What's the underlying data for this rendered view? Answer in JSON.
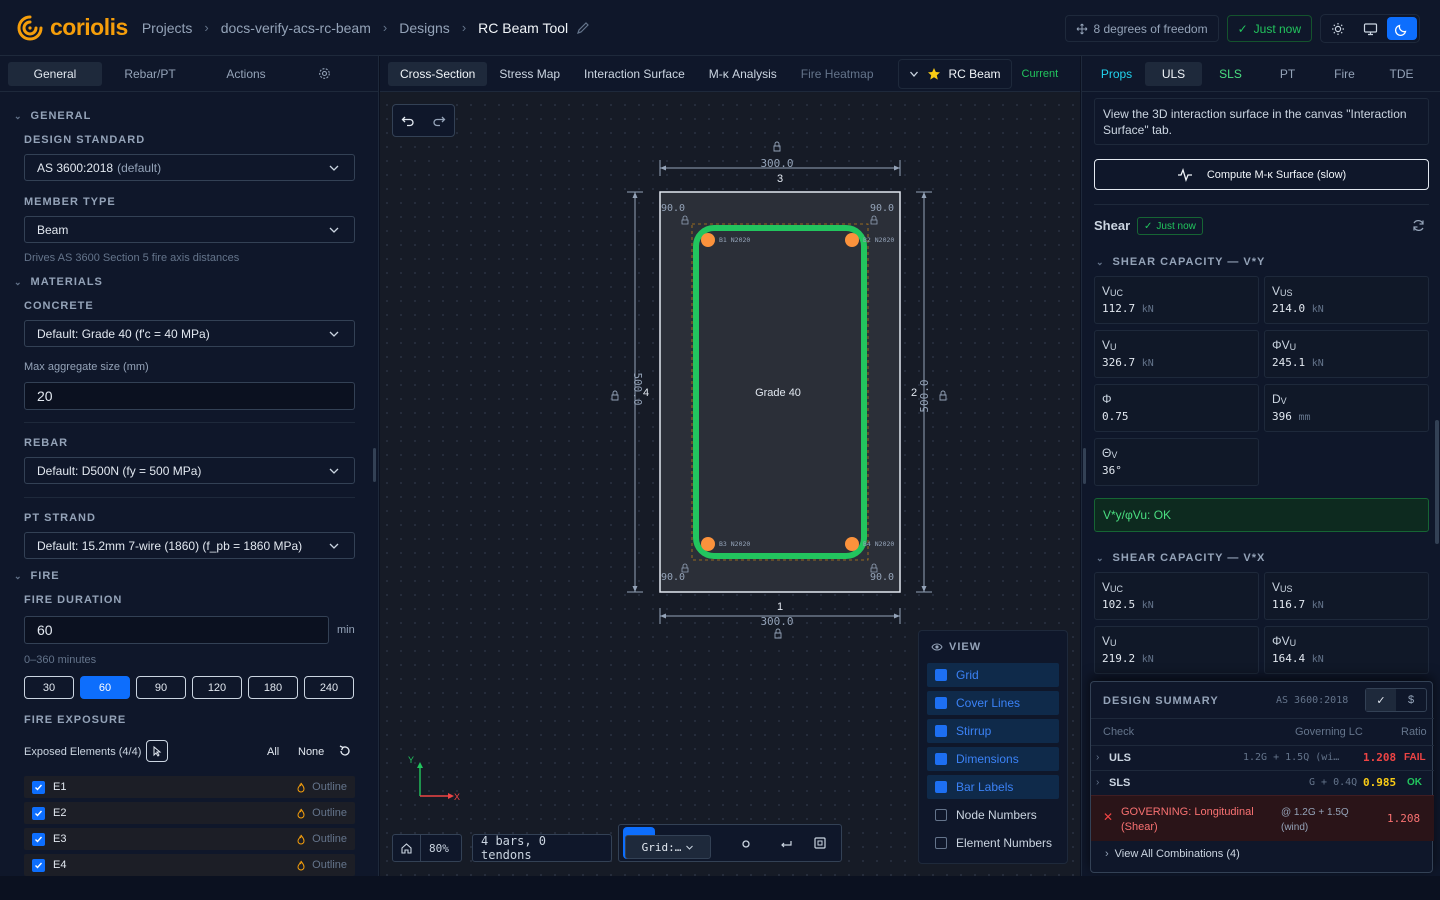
{
  "app": {
    "name": "coriolis"
  },
  "breadcrumb": [
    "Projects",
    "docs-verify-acs-rc-beam",
    "Designs",
    "RC Beam Tool"
  ],
  "topbar": {
    "dof": "8 degrees of freedom",
    "saved": "Just now"
  },
  "left": {
    "tabs": [
      "General",
      "Rebar/PT",
      "Actions"
    ],
    "sections": {
      "general": "GENERAL",
      "materials": "MATERIALS",
      "fire": "FIRE"
    },
    "design_standard": {
      "label": "DESIGN STANDARD",
      "value": "AS 3600:2018",
      "suffix": "(default)"
    },
    "member_type": {
      "label": "MEMBER TYPE",
      "value": "Beam",
      "hint": "Drives AS 3600 Section 5 fire axis distances"
    },
    "concrete": {
      "label": "CONCRETE",
      "value": "Default: Grade 40 (f'c = 40 MPa)"
    },
    "aggregate": {
      "label": "Max aggregate size (mm)",
      "value": "20"
    },
    "rebar": {
      "label": "REBAR",
      "value": "Default: D500N (fy = 500 MPa)"
    },
    "pt": {
      "label": "PT STRAND",
      "value": "Default: 15.2mm 7-wire (1860) (f_pb = 1860 MPa)"
    },
    "fire_duration": {
      "label": "FIRE DURATION",
      "value": "60",
      "unit": "min",
      "hint": "0–360 minutes",
      "options": [
        "30",
        "60",
        "90",
        "120",
        "180",
        "240"
      ]
    },
    "fire_exposure": {
      "label": "FIRE EXPOSURE",
      "exposed": "Exposed Elements (4/4)",
      "all": "All",
      "none": "None",
      "elements": [
        "E1",
        "E2",
        "E3",
        "E4"
      ],
      "outline": "Outline"
    }
  },
  "canvas": {
    "tabs": [
      "Cross-Section",
      "Stress Map",
      "Interaction Surface",
      "M-κ Analysis",
      "Fire Heatmap"
    ],
    "design_name": "RC Beam",
    "status": "Current",
    "section": {
      "material": "Grade 40",
      "width": "300.0",
      "depth": "500.0",
      "cover_labels": [
        "90.0",
        "90.0",
        "90.0",
        "90.0"
      ],
      "edges": [
        "1",
        "2",
        "3",
        "4"
      ],
      "bars": [
        "B1 N2020",
        "B2 N2020",
        "B3 N2020",
        "B4 N2020"
      ]
    },
    "axes": {
      "x": "X",
      "y": "Y"
    },
    "zoom": "80%",
    "bar_count": "4 bars, 0 tendons",
    "grid_select": "Grid:…",
    "view": {
      "title": "VIEW",
      "items": [
        {
          "label": "Grid",
          "on": true
        },
        {
          "label": "Cover Lines",
          "on": true
        },
        {
          "label": "Stirrup",
          "on": true
        },
        {
          "label": "Dimensions",
          "on": true
        },
        {
          "label": "Bar Labels",
          "on": true
        },
        {
          "label": "Node Numbers",
          "on": false
        },
        {
          "label": "Element Numbers",
          "on": false
        }
      ]
    }
  },
  "right": {
    "tabs": [
      "Props",
      "ULS",
      "SLS",
      "PT",
      "Fire",
      "TDE"
    ],
    "info": "View the 3D interaction surface in the canvas \"Interaction Surface\" tab.",
    "compute_label": "Compute M-κ Surface (slow)",
    "shear": {
      "title": "Shear",
      "badge": "Just now"
    },
    "shear_y": {
      "title": "SHEAR CAPACITY — V*Y",
      "cards": [
        {
          "k": "V",
          "sub": "UC",
          "v": "112.7",
          "u": "kN"
        },
        {
          "k": "V",
          "sub": "US",
          "v": "214.0",
          "u": "kN"
        },
        {
          "k": "V",
          "sub": "U",
          "v": "326.7",
          "u": "kN"
        },
        {
          "k": "ΦV",
          "sub": "U",
          "v": "245.1",
          "u": "kN"
        },
        {
          "k": "Φ",
          "sub": "",
          "v": "0.75",
          "u": ""
        },
        {
          "k": "D",
          "sub": "V",
          "v": "396",
          "u": "mm"
        },
        {
          "k": "Θ",
          "sub": "V",
          "v": "36°",
          "u": ""
        }
      ],
      "status": "V*y/φVu: OK"
    },
    "shear_x": {
      "title": "SHEAR CAPACITY — V*X",
      "cards": [
        {
          "k": "V",
          "sub": "UC",
          "v": "102.5",
          "u": "kN"
        },
        {
          "k": "V",
          "sub": "US",
          "v": "116.7",
          "u": "kN"
        },
        {
          "k": "V",
          "sub": "U",
          "v": "219.2",
          "u": "kN"
        },
        {
          "k": "ΦV",
          "sub": "U",
          "v": "164.4",
          "u": "kN"
        }
      ]
    },
    "summary": {
      "title": "DESIGN SUMMARY",
      "standard": "AS 3600:2018",
      "headers": [
        "Check",
        "Governing LC",
        "Ratio"
      ],
      "rows": [
        {
          "check": "ULS",
          "lc": "1.2G + 1.5Q (wi…",
          "ratio": "1.208",
          "status": "FAIL"
        },
        {
          "check": "SLS",
          "lc": "G + 0.4Q",
          "ratio": "0.985",
          "status": "OK"
        }
      ],
      "governing": {
        "text": "GOVERNING: Longitudinal (Shear)",
        "lc": "@ 1.2G + 1.5Q (wind)",
        "ratio": "1.208"
      },
      "view_all": "View All Combinations (4)"
    }
  },
  "colors": {
    "accent": "#0d6efd",
    "brand": "#f59e0b",
    "ok": "#22c55e",
    "fail": "#ef4444",
    "stirrup": "#22c55e",
    "bar": "#fb923c"
  }
}
